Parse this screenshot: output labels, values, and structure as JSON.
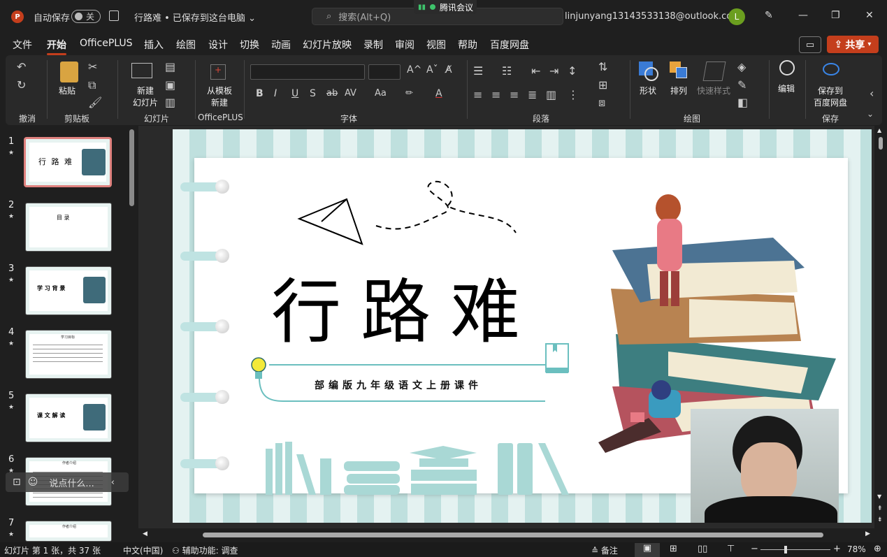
{
  "titlebar": {
    "app_logo": "P",
    "autosave_label": "自动保存",
    "autosave_state": "关",
    "doc_title": "行路难 • 已保存到这台电脑",
    "search_placeholder": "搜索(Alt+Q)",
    "meeting_label": "腾讯会议",
    "account_email": "linjunyang13143533138@outlook.com",
    "avatar_letter": "L",
    "avatar_color": "#6b9e1f"
  },
  "menu": {
    "tabs": [
      "文件",
      "开始",
      "OfficePLUS",
      "插入",
      "绘图",
      "设计",
      "切换",
      "动画",
      "幻灯片放映",
      "录制",
      "审阅",
      "视图",
      "帮助",
      "百度网盘"
    ],
    "active_tab": "开始",
    "share_label": "共享",
    "accent_color": "#c43e1c"
  },
  "ribbon": {
    "groups": {
      "undo": "撤消",
      "clipboard": "剪贴板",
      "slides": "幻灯片",
      "officeplus": "OfficePLUS",
      "font": "字体",
      "paragraph": "段落",
      "drawing": "绘图",
      "save": "保存"
    },
    "buttons": {
      "paste": "粘贴",
      "new_slide_1": "新建",
      "new_slide_2": "幻灯片",
      "from_template_1": "从模板",
      "from_template_2": "新建",
      "shapes": "形状",
      "arrange": "排列",
      "quick_styles": "快速样式",
      "edit": "编辑",
      "save_baidu_1": "保存到",
      "save_baidu_2": "百度网盘"
    }
  },
  "slides_panel": {
    "slides": [
      {
        "num": "1",
        "title": "行 路 难"
      },
      {
        "num": "2",
        "title": "目   录"
      },
      {
        "num": "3",
        "title": "学 习 背 景"
      },
      {
        "num": "4",
        "title": "学习目标"
      },
      {
        "num": "5",
        "title": "课 文 解 读"
      },
      {
        "num": "6",
        "title": "作者介绍"
      },
      {
        "num": "7",
        "title": "作者介绍"
      }
    ],
    "star": "★",
    "selected": "1"
  },
  "slide": {
    "title": "行路难",
    "subtitle": "部编版九年级语文上册课件"
  },
  "chat": {
    "placeholder": "说点什么..."
  },
  "statusbar": {
    "slide_info": "幻灯片 第 1 张，共 37 张",
    "language": "中文(中国)",
    "accessibility": "辅助功能: 调查",
    "notes": "备注",
    "zoom": "78%"
  }
}
